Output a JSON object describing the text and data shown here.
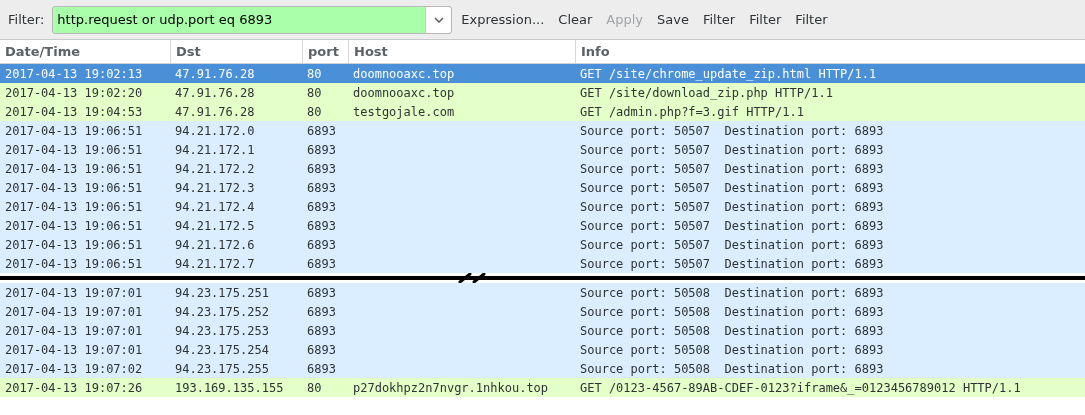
{
  "filter": {
    "label": "Filter:",
    "value": "http.request or udp.port eq 6893",
    "buttons": [
      {
        "label": "Expression...",
        "disabled": false
      },
      {
        "label": "Clear",
        "disabled": false
      },
      {
        "label": "Apply",
        "disabled": true
      },
      {
        "label": "Save",
        "disabled": false
      },
      {
        "label": "Filter",
        "disabled": false
      },
      {
        "label": "Filter",
        "disabled": false
      },
      {
        "label": "Filter",
        "disabled": false
      }
    ]
  },
  "columns": [
    "Date/Time",
    "Dst",
    "port",
    "Host",
    "Info"
  ],
  "rows": [
    {
      "selected": true,
      "gap_before": false,
      "cells": [
        "2017-04-13 19:02:13",
        "47.91.76.28",
        "80",
        "doomnooaxc.top",
        "GET /site/chrome_update_zip.html HTTP/1.1"
      ]
    },
    {
      "kind": "http",
      "selected": false,
      "gap_before": false,
      "cells": [
        "2017-04-13 19:02:20",
        "47.91.76.28",
        "80",
        "doomnooaxc.top",
        "GET /site/download_zip.php HTTP/1.1"
      ]
    },
    {
      "kind": "http",
      "selected": false,
      "gap_before": false,
      "cells": [
        "2017-04-13 19:04:53",
        "47.91.76.28",
        "80",
        "testgojale.com",
        "GET /admin.php?f=3.gif HTTP/1.1"
      ]
    },
    {
      "kind": "udp",
      "selected": false,
      "gap_before": false,
      "cells": [
        "2017-04-13 19:06:51",
        "94.21.172.0",
        "6893",
        "",
        "Source port: 50507  Destination port: 6893"
      ]
    },
    {
      "kind": "udp",
      "selected": false,
      "gap_before": false,
      "cells": [
        "2017-04-13 19:06:51",
        "94.21.172.1",
        "6893",
        "",
        "Source port: 50507  Destination port: 6893"
      ]
    },
    {
      "kind": "udp",
      "selected": false,
      "gap_before": false,
      "cells": [
        "2017-04-13 19:06:51",
        "94.21.172.2",
        "6893",
        "",
        "Source port: 50507  Destination port: 6893"
      ]
    },
    {
      "kind": "udp",
      "selected": false,
      "gap_before": false,
      "cells": [
        "2017-04-13 19:06:51",
        "94.21.172.3",
        "6893",
        "",
        "Source port: 50507  Destination port: 6893"
      ]
    },
    {
      "kind": "udp",
      "selected": false,
      "gap_before": false,
      "cells": [
        "2017-04-13 19:06:51",
        "94.21.172.4",
        "6893",
        "",
        "Source port: 50507  Destination port: 6893"
      ]
    },
    {
      "kind": "udp",
      "selected": false,
      "gap_before": false,
      "cells": [
        "2017-04-13 19:06:51",
        "94.21.172.5",
        "6893",
        "",
        "Source port: 50507  Destination port: 6893"
      ]
    },
    {
      "kind": "udp",
      "selected": false,
      "gap_before": false,
      "cells": [
        "2017-04-13 19:06:51",
        "94.21.172.6",
        "6893",
        "",
        "Source port: 50507  Destination port: 6893"
      ]
    },
    {
      "kind": "udp",
      "selected": false,
      "gap_before": false,
      "cells": [
        "2017-04-13 19:06:51",
        "94.21.172.7",
        "6893",
        "",
        "Source port: 50507  Destination port: 6893"
      ]
    },
    {
      "kind": "udp",
      "selected": false,
      "gap_before": true,
      "cells": [
        "2017-04-13 19:07:01",
        "94.23.175.251",
        "6893",
        "",
        "Source port: 50508  Destination port: 6893"
      ]
    },
    {
      "kind": "udp",
      "selected": false,
      "gap_before": false,
      "cells": [
        "2017-04-13 19:07:01",
        "94.23.175.252",
        "6893",
        "",
        "Source port: 50508  Destination port: 6893"
      ]
    },
    {
      "kind": "udp",
      "selected": false,
      "gap_before": false,
      "cells": [
        "2017-04-13 19:07:01",
        "94.23.175.253",
        "6893",
        "",
        "Source port: 50508  Destination port: 6893"
      ]
    },
    {
      "kind": "udp",
      "selected": false,
      "gap_before": false,
      "cells": [
        "2017-04-13 19:07:01",
        "94.23.175.254",
        "6893",
        "",
        "Source port: 50508  Destination port: 6893"
      ]
    },
    {
      "kind": "udp",
      "selected": false,
      "gap_before": false,
      "cells": [
        "2017-04-13 19:07:02",
        "94.23.175.255",
        "6893",
        "",
        "Source port: 50508  Destination port: 6893"
      ]
    },
    {
      "kind": "http",
      "selected": false,
      "gap_before": false,
      "cells": [
        "2017-04-13 19:07:26",
        "193.169.135.155",
        "80",
        "p27dokhpz2n7nvgr.1nhkou.top",
        "GET /0123-4567-89AB-CDEF-0123?iframe&_=0123456789012 HTTP/1.1"
      ]
    }
  ]
}
